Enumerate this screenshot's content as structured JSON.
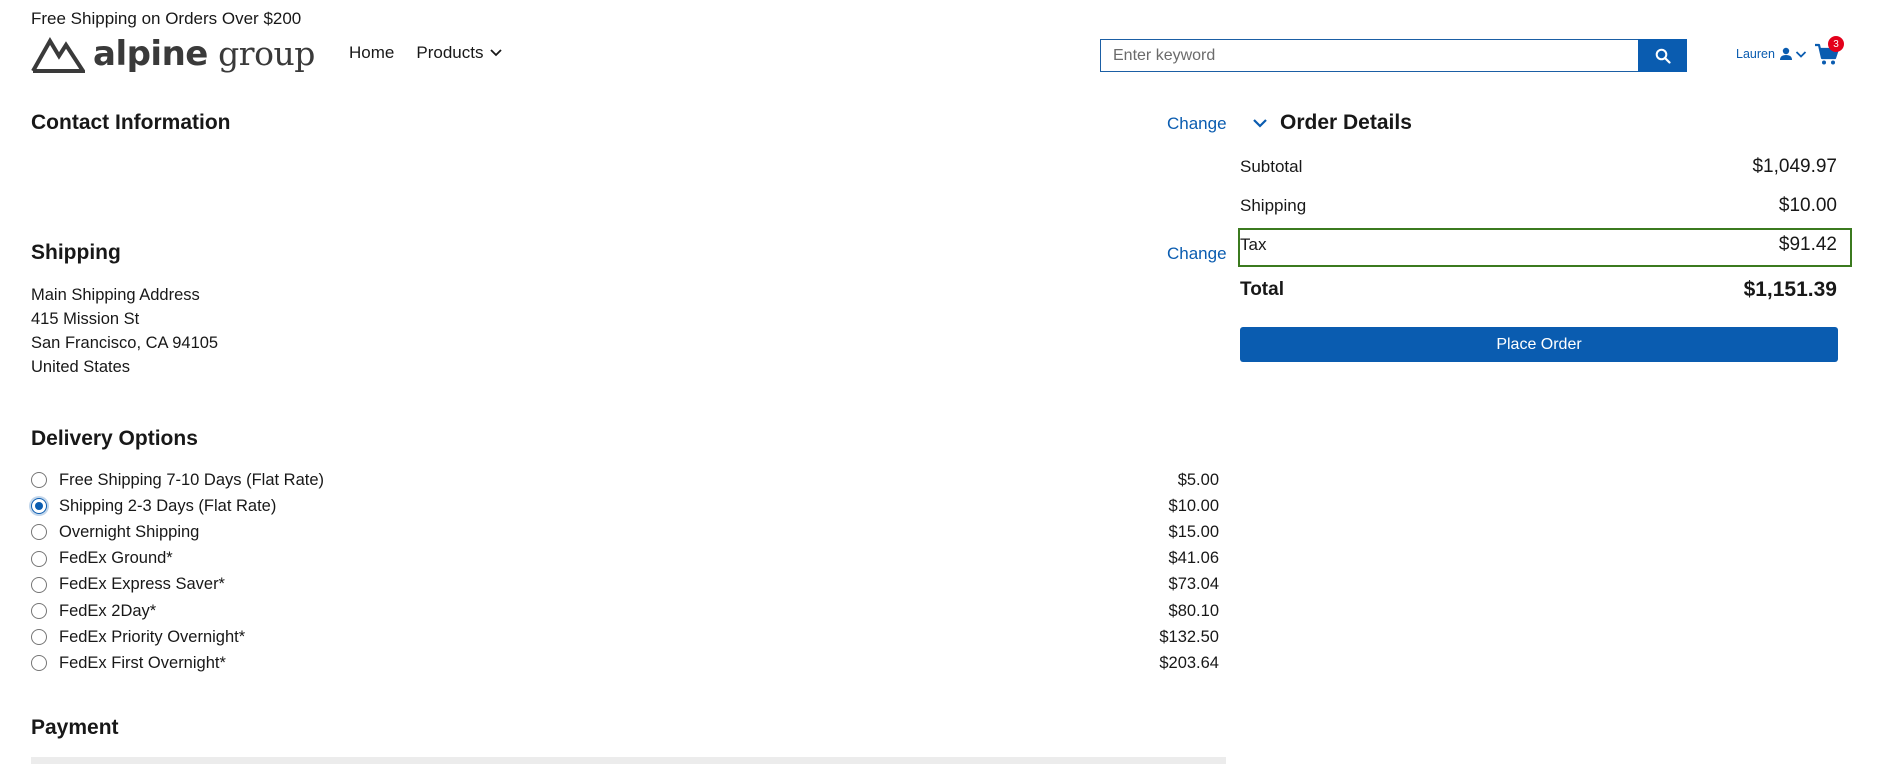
{
  "promo_banner": "Free Shipping on Orders Over $200",
  "logo": {
    "word1": "alpine",
    "word2": "group"
  },
  "nav": {
    "home": "Home",
    "products": "Products"
  },
  "search": {
    "placeholder": "Enter keyword"
  },
  "user": {
    "name": "Lauren"
  },
  "cart": {
    "count": "3"
  },
  "contact": {
    "title": "Contact Information",
    "change_label": "Change"
  },
  "shipping": {
    "title": "Shipping",
    "change_label": "Change",
    "address_lines": [
      "Main Shipping Address",
      "415 Mission St",
      "San Francisco, CA 94105",
      "United States"
    ]
  },
  "delivery": {
    "title": "Delivery Options",
    "options": [
      {
        "label": "Free Shipping 7-10 Days (Flat Rate)",
        "price": "$5.00",
        "selected": false
      },
      {
        "label": "Shipping 2-3 Days (Flat Rate)",
        "price": "$10.00",
        "selected": true
      },
      {
        "label": "Overnight Shipping",
        "price": "$15.00",
        "selected": false
      },
      {
        "label": "FedEx Ground*",
        "price": "$41.06",
        "selected": false
      },
      {
        "label": "FedEx Express Saver*",
        "price": "$73.04",
        "selected": false
      },
      {
        "label": "FedEx 2Day*",
        "price": "$80.10",
        "selected": false
      },
      {
        "label": "FedEx Priority Overnight*",
        "price": "$132.50",
        "selected": false
      },
      {
        "label": "FedEx First Overnight*",
        "price": "$203.64",
        "selected": false
      }
    ]
  },
  "payment": {
    "title": "Payment"
  },
  "order": {
    "title": "Order Details",
    "subtotal_label": "Subtotal",
    "subtotal": "$1,049.97",
    "shipping_label": "Shipping",
    "shipping": "$10.00",
    "tax_label": "Tax",
    "tax": "$91.42",
    "total_label": "Total",
    "total": "$1,151.39",
    "place_order_label": "Place Order"
  },
  "colors": {
    "accent": "#0a5cb0",
    "badge": "#e3001b",
    "highlight_border": "#3b7a1f"
  }
}
